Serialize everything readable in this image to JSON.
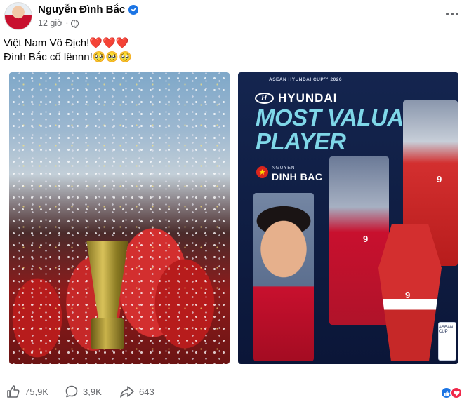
{
  "post": {
    "author": "Nguyễn Đình Bắc",
    "time": "12 giờ",
    "separator": "·",
    "text_line1": "Việt Nam Vô Địch!❤️❤️❤️",
    "text_line2": "Đình Bắc cố lênnn!🥹🥹🥹"
  },
  "images": {
    "left": {
      "description_icon": "trophy-celebration-photo"
    },
    "right": {
      "event": "ASEAN HYUNDAI CUP™ 2026",
      "brand": "HYUNDAI",
      "title_line1": "MOST VALUABLE",
      "title_line2": "PLAYER",
      "player_first": "NGUYEN",
      "player_last": "DINH BAC",
      "jersey_number": "9",
      "badge_text": "ASEAN CUP"
    }
  },
  "actions": {
    "likes": "75,9K",
    "comments": "3,9K",
    "shares": "643"
  },
  "colors": {
    "verified": "#1b74e4",
    "like": "#1b74e4",
    "love": "#f0284a",
    "mvp_text": "#7fd7e8"
  }
}
